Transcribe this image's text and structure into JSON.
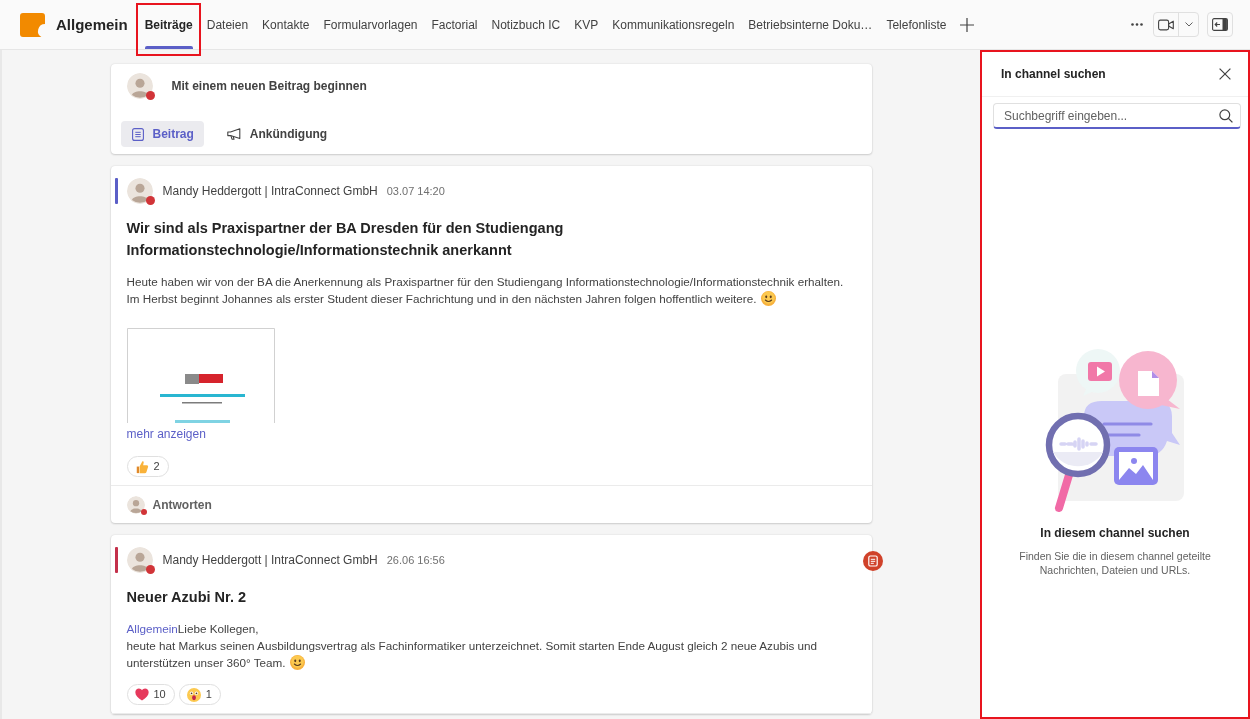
{
  "channel": {
    "name": "Allgemein"
  },
  "tabs": [
    {
      "label": "Beiträge",
      "selected": true,
      "highlighted": true
    },
    {
      "label": "Dateien",
      "selected": false,
      "highlighted": false
    },
    {
      "label": "Kontakte",
      "selected": false,
      "highlighted": false
    },
    {
      "label": "Formularvorlagen",
      "selected": false,
      "highlighted": false
    },
    {
      "label": "Factorial",
      "selected": false,
      "highlighted": false
    },
    {
      "label": "Notizbuch IC",
      "selected": false,
      "highlighted": false
    },
    {
      "label": "KVP",
      "selected": false,
      "highlighted": false
    },
    {
      "label": "Kommunikationsregeln",
      "selected": false,
      "highlighted": false
    },
    {
      "label": "Betriebsinterne Doku…",
      "selected": false,
      "highlighted": false
    },
    {
      "label": "Telefonliste",
      "selected": false,
      "highlighted": false
    }
  ],
  "composer": {
    "busy": true,
    "prompt": "Mit einem neuen Beitrag beginnen",
    "options": [
      {
        "kind": "post",
        "label": "Beitrag",
        "selected": true
      },
      {
        "kind": "announcement",
        "label": "Ankündigung",
        "selected": false
      }
    ]
  },
  "posts": [
    {
      "busy": true,
      "author": "Mandy Heddergott | IntraConnect GmbH",
      "time": "03.07 14:20",
      "important": false,
      "title": "Wir sind als Praxispartner der BA Dresden für den Studiengang Informationstechnologie/Informationstechnik anerkannt",
      "body": [
        {
          "text": "Heute haben wir von der BA die Anerkennung als Praxispartner für den Studiengang Informationstechnologie/Informationstechnik erhalten."
        },
        {
          "text": "Im Herbst beginnt Johannes als erster Student dieser Fachrichtung und in den nächsten Jahren folgen hoffentlich weitere.",
          "smiley": true
        }
      ],
      "image_preview": true,
      "more_link": "mehr anzeigen",
      "reactions": [
        {
          "kind": "like",
          "count": "2"
        }
      ],
      "reply": {
        "busy": true,
        "label": "Antworten"
      }
    },
    {
      "busy": true,
      "author": "Mandy Heddergott | IntraConnect GmbH",
      "time": "26.06 16:56",
      "important": true,
      "title": "Neuer Azubi Nr. 2",
      "body": [
        {
          "mention": "Allgemein",
          "text": "Liebe Kollegen,"
        },
        {
          "text": "heute hat Markus seinen Ausbildungsvertrag als Fachinformatiker unterzeichnet. Somit starten Ende August gleich 2 neue Azubis und"
        },
        {
          "text": "unterstützen unser 360° Team.",
          "smiley": true
        }
      ],
      "reactions": [
        {
          "kind": "heart",
          "count": "10"
        },
        {
          "kind": "surprised",
          "count": "1"
        }
      ]
    }
  ],
  "search_panel": {
    "highlighted": true,
    "title": "In channel suchen",
    "placeholder": "Suchbegriff eingeben...",
    "empty_state": {
      "heading": "In diesem channel suchen",
      "text": "Finden Sie die in diesem channel geteilte Nachrichten, Dateien und URLs."
    }
  }
}
